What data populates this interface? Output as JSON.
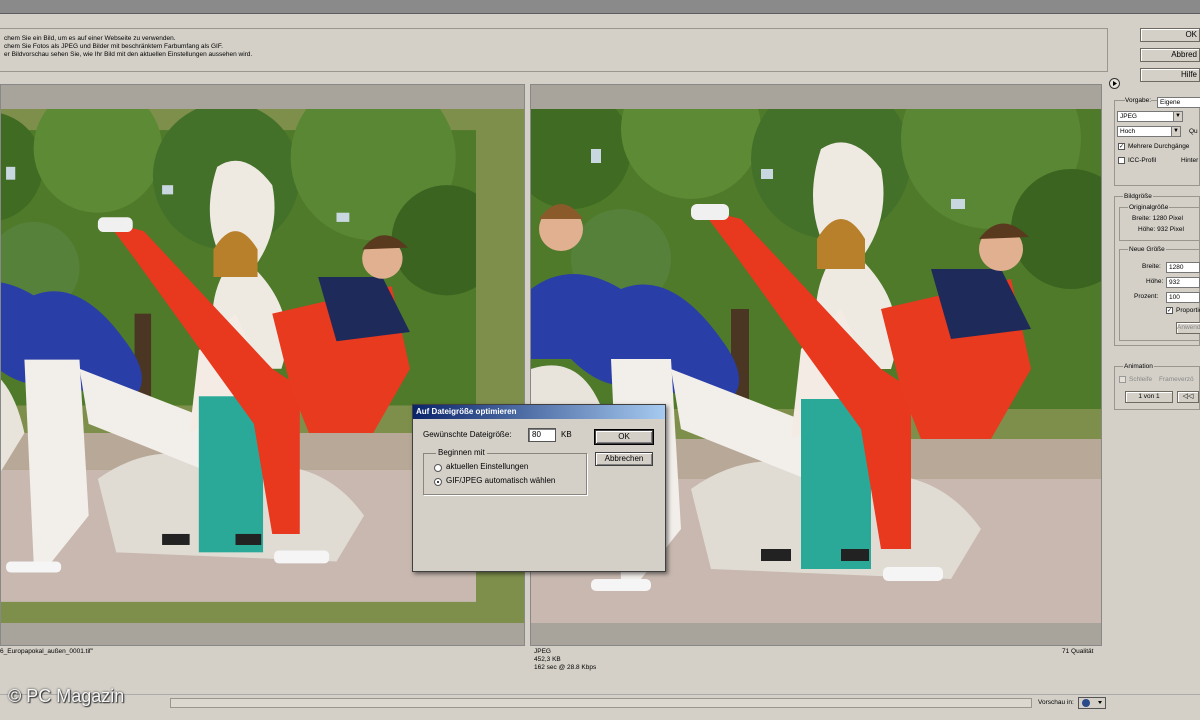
{
  "header": {
    "info_lines": [
      "chem Sie ein Bild, um es auf einer Webseite zu verwenden.",
      "chem Sie Fotos als JPEG und Bilder mit beschränktem Farbumfang als GIF.",
      "er Bildvorschau sehen Sie, wie Ihr Bild mit den aktuellen Einstellungen aussehen wird."
    ]
  },
  "buttons": {
    "ok": "OK",
    "cancel": "Abbred",
    "help": "Hilfe",
    "play_icon": "play-icon"
  },
  "preview_left": {
    "filename": "6_Europapokal_außen_0001.tif\""
  },
  "preview_right": {
    "format": "JPEG",
    "size": "452,3 KB",
    "time": "162 sec @ 28.8 Kbps",
    "quality": "71 Qualität"
  },
  "settings": {
    "preset_label": "Vorgabe:",
    "preset_value": "Eigene",
    "format_value": "JPEG",
    "quality_value": "Hoch",
    "quality_label": "Qu",
    "progressive_label": "Mehrere Durchgänge",
    "progressive_checked": true,
    "icc_label": "ICC-Profil",
    "icc_checked": false,
    "hintergrund_label": "Hinter"
  },
  "image_size": {
    "group_label": "Bildgröße",
    "original_label": "Originalgröße",
    "orig_width": "Breite: 1280 Pixel",
    "orig_height": "Höhe: 932 Pixel",
    "new_size_label": "Neue Größe",
    "width_label": "Breite:",
    "width_value": "1280",
    "height_label": "Höhe:",
    "height_value": "932",
    "percent_label": "Prozent:",
    "percent_value": "100",
    "proportion_label": "Proportione",
    "proportion_checked": true,
    "apply_label": "Anwend"
  },
  "animation": {
    "group_label": "Animation",
    "loop_label": "Schleife",
    "frame_label": "Frameverzö",
    "frame_counter": "1 von 1",
    "rewind_icon": "rewind-icon"
  },
  "footer": {
    "preview_in_label": "Vorschau in:",
    "browser_icon": "browser-icon",
    "watermark": "© PC Magazin"
  },
  "dialog": {
    "title": "Auf Dateigröße optimieren",
    "size_label": "Gewünschte Dateigröße:",
    "size_value": "80",
    "size_unit": "KB",
    "ok": "OK",
    "cancel": "Abbrechen",
    "group_label": "Beginnen mit",
    "option_current": "aktuellen Einstellungen",
    "option_auto": "GIF/JPEG automatisch wählen",
    "selected_option": "GIF/JPEG automatisch wählen"
  }
}
